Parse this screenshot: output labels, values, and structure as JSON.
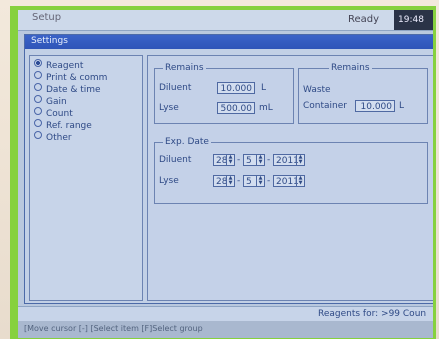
{
  "topbar": {
    "title": "Setup",
    "status": "Ready",
    "time": "19:48"
  },
  "window": {
    "title": "Settings"
  },
  "menu": {
    "items": [
      {
        "label": "Reagent",
        "selected": true
      },
      {
        "label": "Print & comm",
        "selected": false
      },
      {
        "label": "Date & time",
        "selected": false
      },
      {
        "label": "Gain",
        "selected": false
      },
      {
        "label": "Count",
        "selected": false
      },
      {
        "label": "Ref. range",
        "selected": false
      },
      {
        "label": "Other",
        "selected": false
      }
    ]
  },
  "remains_left": {
    "legend": "Remains",
    "diluent_label": "Diluent",
    "diluent_value": "10.000",
    "diluent_unit": "L",
    "lyse_label": "Lyse",
    "lyse_value": "500.00",
    "lyse_unit": "mL"
  },
  "remains_right": {
    "legend": "Remains",
    "waste_label": "Waste",
    "container_label": "Container",
    "container_value": "10.000",
    "container_unit": "L"
  },
  "exp_date": {
    "legend": "Exp. Date",
    "diluent_label": "Diluent",
    "diluent_day": "28",
    "diluent_month": "5",
    "diluent_year": "2011",
    "lyse_label": "Lyse",
    "lyse_day": "28",
    "lyse_month": "5",
    "lyse_year": "2011",
    "separator": "-"
  },
  "footer": {
    "reagents": "Reagents for: >99 Coun"
  },
  "bottombar": {
    "hint": "[Move cursor [-] [Select item [F]Select group"
  }
}
